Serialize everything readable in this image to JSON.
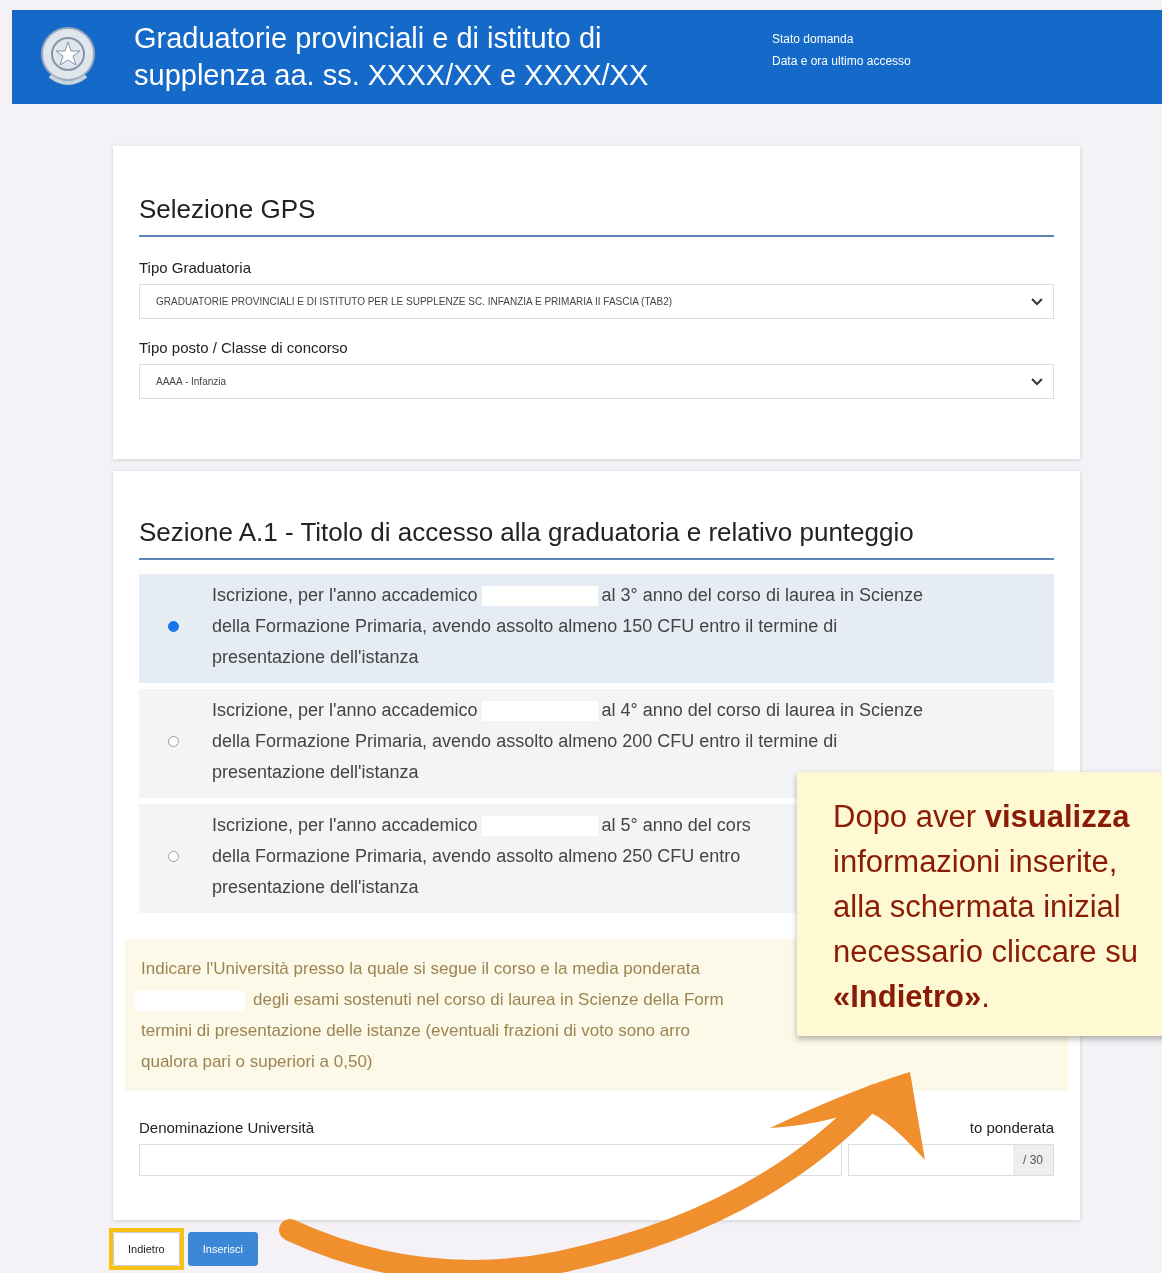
{
  "header": {
    "title_lines": [
      "Graduatorie provinciali e di istituto di",
      "supplenza aa. ss.  XXXX/XX   e  XXXX/XX"
    ],
    "status": "Stato domanda",
    "last_access": "Data e ora ultimo accesso"
  },
  "selection": {
    "title": "Selezione GPS",
    "fields": [
      {
        "label": "Tipo Graduatoria",
        "value": "GRADUATORIE PROVINCIALI E DI ISTITUTO PER LE SUPPLENZE SC. INFANZIA E PRIMARIA II FASCIA (TAB2)"
      },
      {
        "label": "Tipo posto / Classe di concorso",
        "value": "AAAA - Infanzia"
      }
    ]
  },
  "section": {
    "title": "Sezione A.1 - Titolo di accesso alla graduatoria e relativo punteggio",
    "options": [
      {
        "selected": true,
        "lead": "Iscrizione, per l'anno accademico",
        "lines": [
          "al 3° anno del corso di laurea in Scienze",
          "della Formazione Primaria, avendo assolto almeno 150 CFU entro il termine di",
          "presentazione dell'istanza"
        ]
      },
      {
        "selected": false,
        "lead": "Iscrizione, per l'anno accademico",
        "lines": [
          "al 4° anno del corso di laurea in Scienze",
          "della Formazione Primaria, avendo assolto almeno 200 CFU entro il termine di",
          "presentazione dell'istanza"
        ]
      },
      {
        "selected": false,
        "lead": "Iscrizione, per l'anno accademico",
        "lines": [
          "al 5° anno del cors",
          "della Formazione Primaria, avendo assolto almeno 250 CFU entro",
          "presentazione dell'istanza"
        ]
      }
    ],
    "info_lines": [
      "Indicare l'Università presso la quale si segue il corso e la media ponderata",
      "degli esami sostenuti nel corso di laurea in Scienze della Form",
      "termini di presentazione delle istanze (eventuali frazioni di voto sono arro",
      "qualora pari o superiori a 0,50)"
    ],
    "university_label": "Denominazione Università",
    "average_label": "to ponderata",
    "average_suffix": "/ 30"
  },
  "buttons": [
    {
      "label": "Indietro",
      "kind": "secondary",
      "highlighted": true
    },
    {
      "label": "Inserisci",
      "kind": "primary",
      "highlighted": false
    }
  ],
  "callout": {
    "lines": [
      "Dopo aver **visualizza**",
      "informazioni inserite,",
      "alla schermata inizial",
      "necessario cliccare su",
      "**«Indietro»**."
    ]
  }
}
